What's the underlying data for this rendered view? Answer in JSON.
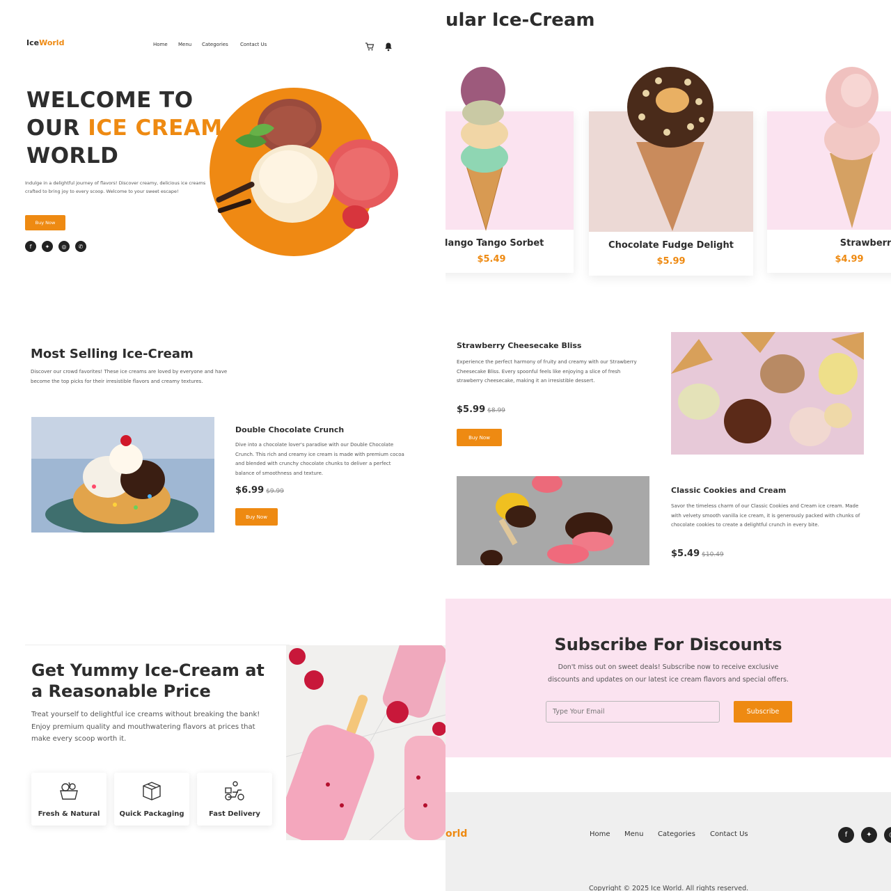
{
  "hero": {
    "logo_part1": "Ice",
    "logo_part2": "World",
    "nav": [
      "Home",
      "Menu",
      "Categories",
      "Contact Us"
    ],
    "title_line1": "WELCOME TO",
    "title_line2a": "OUR ",
    "title_line2b": "ICE CREAM",
    "title_line3": "WORLD",
    "description": "Indulge in a delightful journey of flavors! Discover creamy, delicious ice creams crafted to bring joy to every scoop. Welcome to your sweet escape!",
    "button": "Buy Now",
    "social_icons": [
      "facebook-icon",
      "twitter-icon",
      "pinterest-icon",
      "phone-icon"
    ]
  },
  "popular": {
    "title": "ular Ice-Cream",
    "items": [
      {
        "name": "Mango Tango Sorbet",
        "price": "$5.49"
      },
      {
        "name": "Chocolate Fudge Delight",
        "price": "$5.99"
      },
      {
        "name": "Strawberry Swirl Blis",
        "price": "$4.99"
      }
    ]
  },
  "most_selling": {
    "title": "Most Selling Ice-Cream",
    "description": "Discover our crowd favorites! These ice creams are loved by everyone and have become the top picks for their irresistible flavors and creamy textures.",
    "products": [
      {
        "name": "Double Chocolate Crunch",
        "description": "Dive into a chocolate lover's paradise with our Double Chocolate Crunch. This rich and creamy ice cream is made with premium cocoa and blended with crunchy chocolate chunks to deliver a perfect balance of smoothness and texture.",
        "price": "$6.99",
        "old_price": "$9.99",
        "button": "Buy Now"
      },
      {
        "name": "Strawberry Cheesecake Bliss",
        "description": "Experience the perfect harmony of fruity and creamy with our Strawberry Cheesecake Bliss. Every spoonful feels like enjoying a slice of fresh strawberry cheesecake, making it an irresistible dessert.",
        "price": "$5.99",
        "old_price": "$8.99",
        "button": "Buy Now"
      },
      {
        "name": "Classic Cookies and Cream",
        "description": "Savor the timeless charm of our Classic Cookies and Cream ice cream. Made with velvety smooth vanilla ice cream, it is generously packed with chunks of chocolate cookies to create a delightful crunch in every bite.",
        "price": "$5.49",
        "old_price": "$10.49"
      }
    ]
  },
  "yummy": {
    "title_line1": "Get Yummy Ice-Cream at",
    "title_line2": "a Reasonable Price",
    "description": "Treat yourself to delightful ice creams without breaking the bank! Enjoy premium quality and mouthwatering flavors at prices that make every scoop worth it.",
    "features": [
      {
        "label": "Fresh & Natural",
        "icon": "fruit-basket-icon"
      },
      {
        "label": "Quick Packaging",
        "icon": "box-icon"
      },
      {
        "label": "Fast Delivery",
        "icon": "delivery-scooter-icon"
      }
    ]
  },
  "subscribe": {
    "title": "Subscribe For Discounts",
    "description_line1": "Don't miss out on sweet deals! Subscribe now to receive exclusive",
    "description_line2": "discounts and updates on our latest ice cream flavors and special offers.",
    "placeholder": "Type Your Email",
    "button": "Subscribe"
  },
  "footer": {
    "logo_fragment": "orld",
    "nav": [
      "Home",
      "Menu",
      "Categories",
      "Contact Us"
    ],
    "copyright": "Copyright © 2025 Ice World. All rights reserved."
  },
  "colors": {
    "accent": "#ee8a12",
    "pink_bg": "#fbe3f0",
    "dark": "#2d2d2d",
    "footer_bg": "#efefef"
  }
}
